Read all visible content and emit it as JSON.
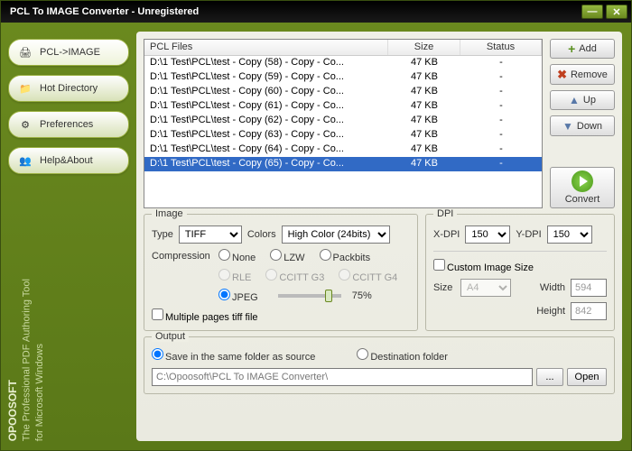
{
  "title": "PCL To IMAGE Converter - Unregistered",
  "sidebar": {
    "items": [
      {
        "label": "PCL->IMAGE"
      },
      {
        "label": "Hot Directory"
      },
      {
        "label": "Preferences"
      },
      {
        "label": "Help&About"
      }
    ],
    "brand": "OPOOSOFT",
    "tagline1": "The Professional PDF Authoring Tool",
    "tagline2": "for Microsoft Windows"
  },
  "list": {
    "headers": {
      "file": "PCL Files",
      "size": "Size",
      "status": "Status"
    },
    "rows": [
      {
        "file": "D:\\1 Test\\PCL\\test - Copy (58) - Copy - Co...",
        "size": "47 KB",
        "status": "-"
      },
      {
        "file": "D:\\1 Test\\PCL\\test - Copy (59) - Copy - Co...",
        "size": "47 KB",
        "status": "-"
      },
      {
        "file": "D:\\1 Test\\PCL\\test - Copy (60) - Copy - Co...",
        "size": "47 KB",
        "status": "-"
      },
      {
        "file": "D:\\1 Test\\PCL\\test - Copy (61) - Copy - Co...",
        "size": "47 KB",
        "status": "-"
      },
      {
        "file": "D:\\1 Test\\PCL\\test - Copy (62) - Copy - Co...",
        "size": "47 KB",
        "status": "-"
      },
      {
        "file": "D:\\1 Test\\PCL\\test - Copy (63) - Copy - Co...",
        "size": "47 KB",
        "status": "-"
      },
      {
        "file": "D:\\1 Test\\PCL\\test - Copy (64) - Copy - Co...",
        "size": "47 KB",
        "status": "-"
      },
      {
        "file": "D:\\1 Test\\PCL\\test - Copy (65) - Copy - Co...",
        "size": "47 KB",
        "status": "-"
      }
    ]
  },
  "buttons": {
    "add": "Add",
    "remove": "Remove",
    "up": "Up",
    "down": "Down",
    "convert": "Convert",
    "browse": "...",
    "open": "Open"
  },
  "image": {
    "title": "Image",
    "type_label": "Type",
    "type_value": "TIFF",
    "colors_label": "Colors",
    "colors_value": "High Color (24bits)",
    "compression_label": "Compression",
    "comp_none": "None",
    "comp_lzw": "LZW",
    "comp_packbits": "Packbits",
    "comp_rle": "RLE",
    "comp_g3": "CCITT G3",
    "comp_g4": "CCITT G4",
    "comp_jpeg": "JPEG",
    "jpeg_quality": "75%",
    "multipage_label": "Multiple pages tiff file"
  },
  "dpi": {
    "title": "DPI",
    "x_label": "X-DPI",
    "x_value": "150",
    "y_label": "Y-DPI",
    "y_value": "150",
    "custom_label": "Custom Image Size",
    "size_label": "Size",
    "size_value": "A4",
    "width_label": "Width",
    "width_value": "594",
    "height_label": "Height",
    "height_value": "842"
  },
  "output": {
    "title": "Output",
    "same_folder": "Save in the same folder as source",
    "dest_folder": "Destination folder",
    "path": "C:\\Opoosoft\\PCL To IMAGE Converter\\"
  }
}
